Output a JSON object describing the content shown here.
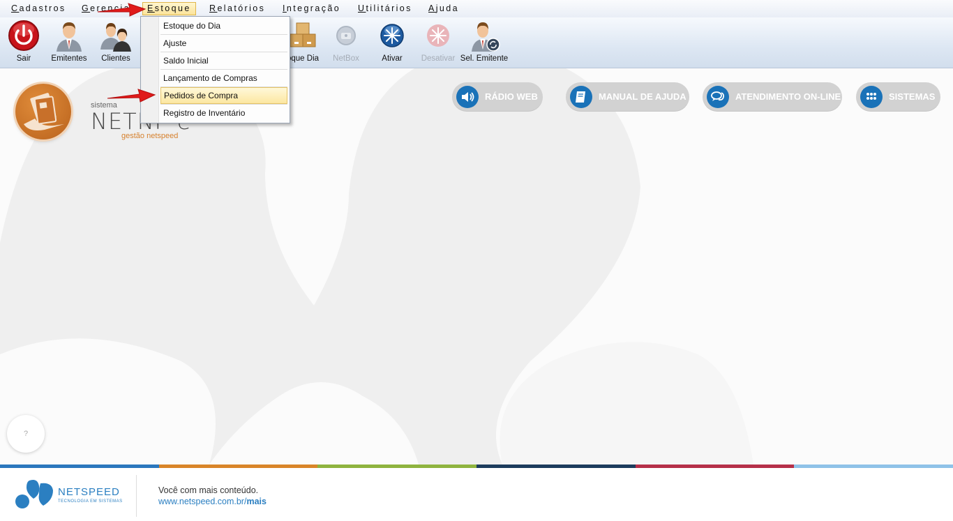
{
  "menu": {
    "items": [
      {
        "label": "Cadastros"
      },
      {
        "label": "Gerencial"
      },
      {
        "label": "Estoque"
      },
      {
        "label": "Relatórios"
      },
      {
        "label": "Integração"
      },
      {
        "label": "Utilitários"
      },
      {
        "label": "Ajuda"
      }
    ],
    "active": "Estoque"
  },
  "toolbar": {
    "buttons": [
      {
        "label": "Sair",
        "icon": "power-icon",
        "enabled": true
      },
      {
        "label": "Emitentes",
        "icon": "user-icon",
        "enabled": true
      },
      {
        "label": "Clientes",
        "icon": "users-icon",
        "enabled": true
      },
      {
        "label": "oque Dia",
        "icon": "boxes-icon",
        "enabled": true
      },
      {
        "label": "NetBox",
        "icon": "netbox-icon",
        "enabled": false
      },
      {
        "label": "Ativar",
        "icon": "activate-icon",
        "enabled": true
      },
      {
        "label": "Desativar",
        "icon": "deactivate-icon",
        "enabled": false
      },
      {
        "label": "Sel. Emitente",
        "icon": "select-issuer-icon",
        "enabled": true
      }
    ]
  },
  "dropdown": {
    "items": [
      {
        "label": "Estoque do Dia"
      },
      {
        "label": "Ajuste"
      },
      {
        "label": "Saldo Inicial"
      },
      {
        "label": "Lançamento de Compras"
      },
      {
        "label": "Pedidos de Compra",
        "highlighted": true
      },
      {
        "label": "Registro de Inventário"
      }
    ]
  },
  "brand": {
    "sistema": "sistema",
    "name": "NETNF-e",
    "tagline": "gestão netspeed"
  },
  "links": [
    {
      "label": "RÁDIO WEB",
      "icon": "speaker-icon"
    },
    {
      "label": "MANUAL DE AJUDA",
      "icon": "book-icon"
    },
    {
      "label": "ATENDIMENTO ON-LINE",
      "icon": "chat-icon"
    },
    {
      "label": "SISTEMAS",
      "icon": "grid-icon"
    }
  ],
  "help_button": {
    "label": "?"
  },
  "footer": {
    "company": "NETSPEED",
    "company_sub": "TECNOLOGIA EM SISTEMAS",
    "tagline": "Você com mais conteúdo.",
    "url_prefix": "www.netspeed.com.br/",
    "url_bold": "mais"
  },
  "colors": {
    "strip": [
      "#2b77bd",
      "#d98529",
      "#8fb43f",
      "#1d3c5d",
      "#b63049",
      "#8fc2e8"
    ],
    "accent_blue": "#1a72b8",
    "accent_orange": "#d6812e",
    "arrow_red": "#e01b1b"
  }
}
